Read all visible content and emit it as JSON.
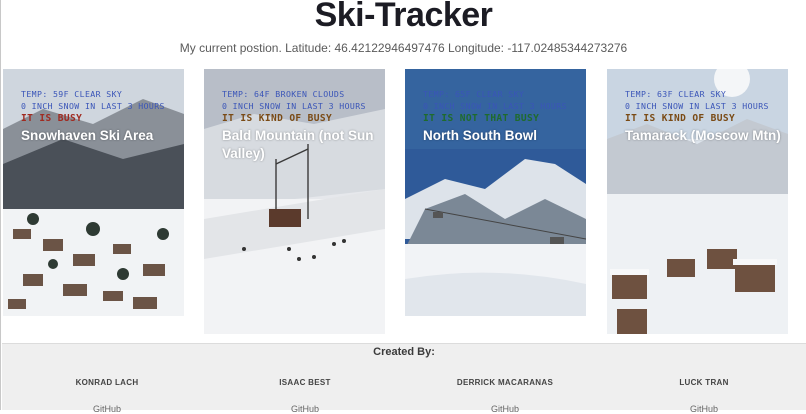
{
  "header": {
    "title": "Ski-Tracker",
    "position_text": "My current postion. Latitude: 46.42122946497476 Longitude: -117.02485344273276"
  },
  "resorts": [
    {
      "temp": "TEMP: 59F CLEAR SKY",
      "snow": "0 INCH SNOW IN LAST 3 HOURS",
      "busy": "IT IS BUSY",
      "busy_color": "#a02a20",
      "name": "Snowhaven Ski Area"
    },
    {
      "temp": "TEMP: 64F BROKEN CLOUDS",
      "snow": "0 INCH SNOW IN LAST 3 HOURS",
      "busy": "IT IS KIND OF BUSY",
      "busy_color": "#7a4a14",
      "name": "Bald Mountain (not Sun Valley)"
    },
    {
      "temp": "TEMP: 65F CLEAR SKY",
      "snow": "0 INCH SNOW IN LAST 3 HOURS",
      "busy": "IT IS NOT THAT BUSY",
      "busy_color": "#1f6b2c",
      "name": "North South Bowl"
    },
    {
      "temp": "TEMP: 63F CLEAR SKY",
      "snow": "0 INCH SNOW IN LAST 3 HOURS",
      "busy": "IT IS KIND OF BUSY",
      "busy_color": "#7a4a14",
      "name": "Tamarack (Moscow Mtn)"
    }
  ],
  "footer": {
    "created_by": "Created By:",
    "members": [
      {
        "name": "KONRAD LACH",
        "link": "GitHub"
      },
      {
        "name": "ISAAC BEST",
        "link": "GitHub"
      },
      {
        "name": "DERRICK MACARANAS",
        "link": "GitHub"
      },
      {
        "name": "LUCK TRAN",
        "link": "GitHub"
      }
    ]
  }
}
